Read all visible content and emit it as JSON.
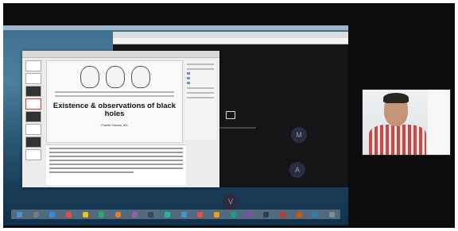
{
  "slide": {
    "title": "Existence & observations of black holes",
    "author": "Prateek Sharma, IISc"
  },
  "browser": {
    "participants": [
      "M",
      "A",
      "V"
    ]
  },
  "colors": {
    "background": "#0c0c0e",
    "desktop_sea": "#2d5a77",
    "shirt_red": "#c44a4a"
  }
}
